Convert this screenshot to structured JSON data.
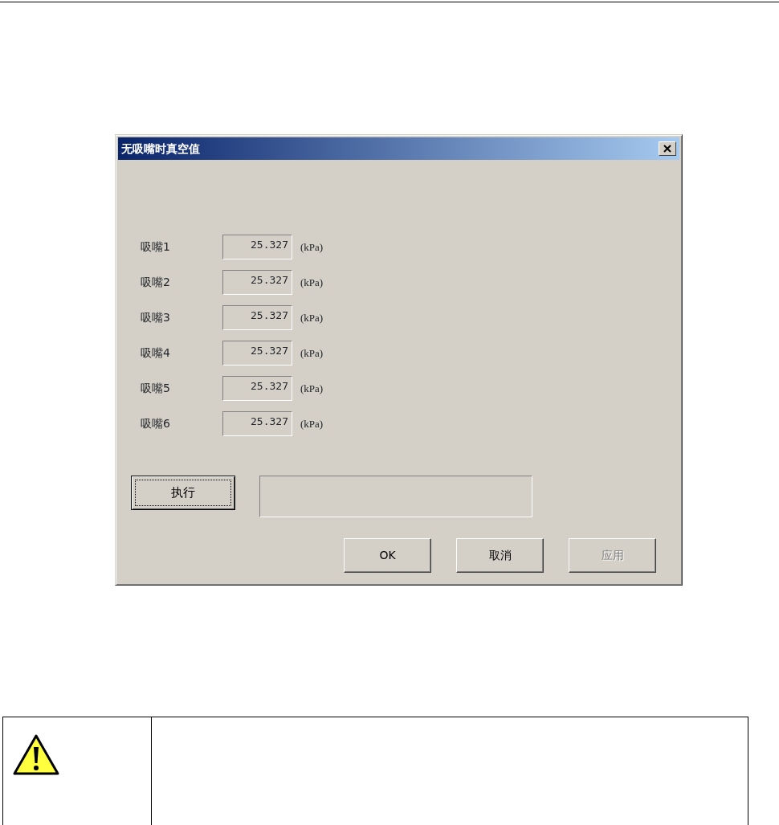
{
  "dialog": {
    "title": "无吸嘴时真空值",
    "nozzles": [
      {
        "label": "吸嘴1",
        "value": "25.327",
        "unit": "(kPa)"
      },
      {
        "label": "吸嘴2",
        "value": "25.327",
        "unit": "(kPa)"
      },
      {
        "label": "吸嘴3",
        "value": "25.327",
        "unit": "(kPa)"
      },
      {
        "label": "吸嘴4",
        "value": "25.327",
        "unit": "(kPa)"
      },
      {
        "label": "吸嘴5",
        "value": "25.327",
        "unit": "(kPa)"
      },
      {
        "label": "吸嘴6",
        "value": "25.327",
        "unit": "(kPa)"
      }
    ],
    "execute_button": {
      "label": "执行",
      "focused": true
    },
    "buttons": [
      {
        "label": "OK",
        "disabled": false
      },
      {
        "label": "取消",
        "disabled": false
      },
      {
        "label": "应用",
        "disabled": true
      }
    ]
  }
}
